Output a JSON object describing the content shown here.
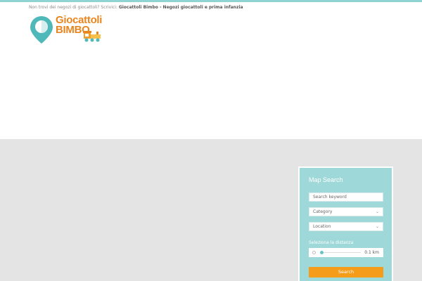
{
  "topbar": {
    "prefix": "Non trovi dei negozi di giocattoli? Scrivici:",
    "link": "Giocattoli Bimbo - Negozi giocattoli e prima infanzia"
  },
  "logo": {
    "line1": "Giocattoli",
    "line2": "BIMBO"
  },
  "search_panel": {
    "title": "Map Search",
    "keyword_placeholder": "Search keyword",
    "category_label": "Category",
    "location_label": "Location",
    "distance_label": "Seleziona la distanza",
    "distance_value": "0.1 km",
    "search_button": "Search"
  },
  "colors": {
    "accent": "#8fd3d3",
    "panel": "#9fd8d8",
    "button": "#f59c1a",
    "logo_orange": "#e8851f",
    "logo_teal": "#4fb8b8"
  },
  "icons": [
    "map-pin-icon",
    "toy-train-icon",
    "chevron-down-icon"
  ]
}
